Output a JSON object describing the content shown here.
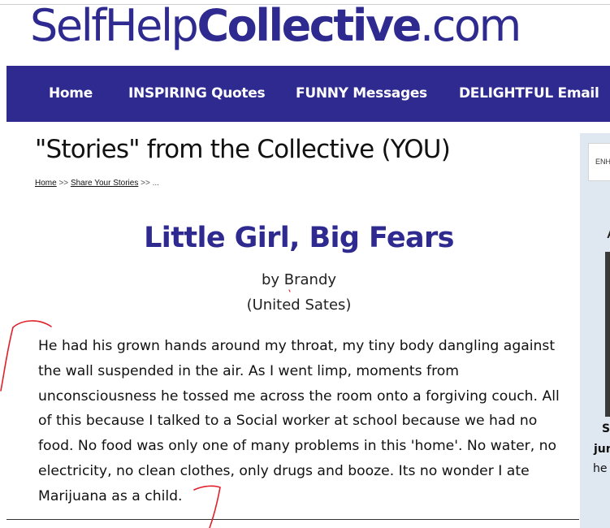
{
  "site": {
    "logo_part1": "SelfHelp",
    "logo_part2": "Collective",
    "logo_part3": ".com"
  },
  "nav": {
    "items": [
      {
        "label": "Home"
      },
      {
        "label": "INSPIRING Quotes"
      },
      {
        "label": "FUNNY Messages"
      },
      {
        "label": "DELIGHTFUL Email"
      }
    ]
  },
  "page": {
    "title": "\"Stories\" from the Collective (YOU)"
  },
  "breadcrumb": {
    "home": "Home",
    "sep1": ">>",
    "share": "Share Your Stories",
    "sep2": ">>",
    "ellipsis": "..."
  },
  "story": {
    "title": "Little Girl, Big Fears",
    "byline": "by Brandy",
    "location": "(United Sates)",
    "lines": [
      "He had his grown hands around my throat, my tiny body dangling against",
      "the wall suspended in the air. As I went limp, moments from",
      "unconsciousness he tossed me across the room onto a forgiving couch. All",
      "of this because I talked to a Social worker at school because we had no",
      "food. No food was only one of many problems in this 'home'. No water, no",
      "electricity, no clean clothes, only drugs and booze. Its no wonder I ate",
      "Marijuana as a child."
    ]
  },
  "sidebar": {
    "search_text": "ENH",
    "heading": "A",
    "snippet_1": "S",
    "snippet_2": "jun",
    "snippet_3": "he"
  },
  "colors": {
    "brand": "#2e2a8f",
    "annotation": "#e0202a",
    "sidebar_bg": "#dfe8f0"
  }
}
